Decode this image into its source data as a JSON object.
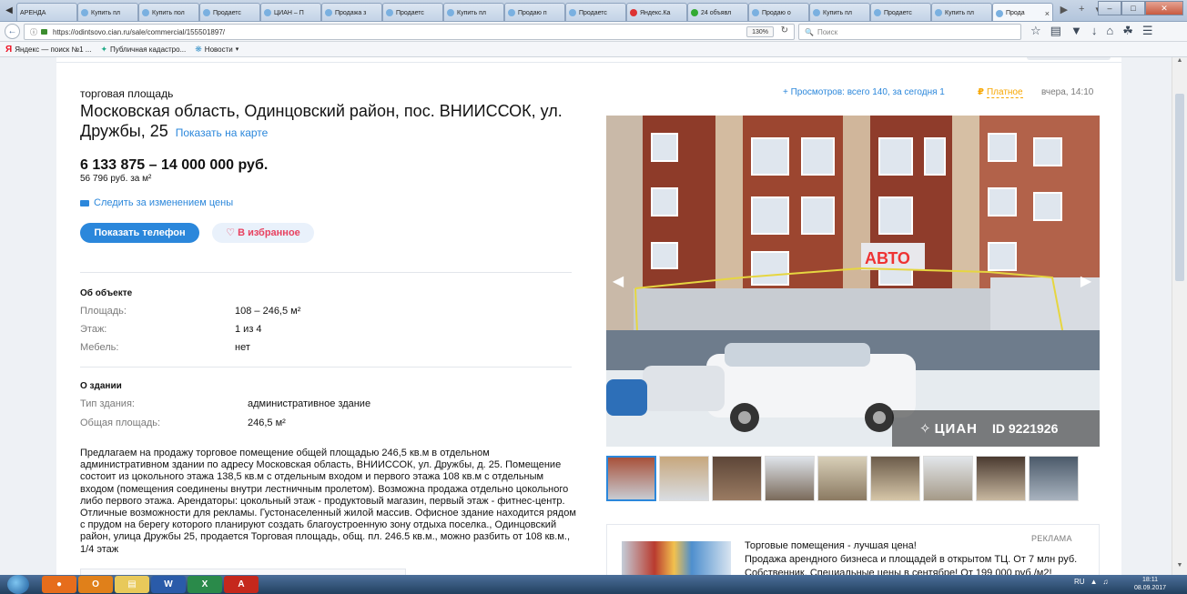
{
  "browser": {
    "tabs": [
      {
        "label": "АРЕНДА",
        "fav": "none"
      },
      {
        "label": "Купить пл",
        "fav": "blue"
      },
      {
        "label": "Купить пол",
        "fav": "blue"
      },
      {
        "label": "Продаетс",
        "fav": "blue"
      },
      {
        "label": "ЦИАН – П",
        "fav": "blue"
      },
      {
        "label": "Продажа з",
        "fav": "blue"
      },
      {
        "label": "Продаетс",
        "fav": "blue"
      },
      {
        "label": "Купить пл",
        "fav": "blue"
      },
      {
        "label": "Продаю п",
        "fav": "blue"
      },
      {
        "label": "Продаетс",
        "fav": "blue"
      },
      {
        "label": "Яндекс.Ка",
        "fav": "red"
      },
      {
        "label": "24 объявл",
        "fav": "green"
      },
      {
        "label": "Продаю о",
        "fav": "blue"
      },
      {
        "label": "Купить пл",
        "fav": "blue"
      },
      {
        "label": "Продаетс",
        "fav": "blue"
      },
      {
        "label": "Купить пл",
        "fav": "blue"
      },
      {
        "label": "Прода",
        "fav": "blue"
      }
    ],
    "url": "https://odintsovo.cian.ru/sale/commercial/155501897/",
    "zoom": "130%",
    "search_placeholder": "Поиск",
    "bookmarks": [
      {
        "label": "Яндекс — поиск №1 ...",
        "icon": "yandex-icon"
      },
      {
        "label": "Публичная кадастро...",
        "icon": "map-icon"
      },
      {
        "label": "Новости",
        "icon": "news-icon"
      }
    ]
  },
  "listing": {
    "kind": "торговая площадь",
    "address": "Московская область, Одинцовский район, пос. ВНИИССОК, ул. Дружбы, 25",
    "map_link": "Показать на карте",
    "price": "6 133 875 – 14 000 000 руб.",
    "price_per_m2": "56 796 руб. за м²",
    "follow_price": "Следить за изменением цены",
    "show_phone": "Показать телефон",
    "favorite": "В избранное",
    "views": "+ Просмотров: всего 140, за сегодня 1",
    "paid": "Платное",
    "date": "вчера, 14:10"
  },
  "about_object": {
    "title": "Об объекте",
    "rows": [
      {
        "label": "Площадь:",
        "value": "108 – 246,5 м²"
      },
      {
        "label": "Этаж:",
        "value": "1 из 4"
      },
      {
        "label": "Мебель:",
        "value": "нет"
      }
    ]
  },
  "about_building": {
    "title": "О здании",
    "rows": [
      {
        "label": "Тип здания:",
        "value": "административное здание"
      },
      {
        "label": "Общая площадь:",
        "value": "246,5 м²"
      }
    ]
  },
  "description": "Предлагаем на продажу торговое помещение общей площадью 246,5 кв.м в отдельном административном здании по адресу Московская область, ВНИИССОК, ул. Дружбы, д. 25. Помещение состоит из цокольного этажа 138,5 кв.м с отдельным входом и первого этажа 108 кв.м с отдельным входом (помещения соединены внутри лестничным пролетом). Возможна продажа отдельно цокольного либо первого этажа. Арендаторы: цокольный этаж - продуктовый магазин, первый этаж - фитнес-центр. Отличные возможности для рекламы. Густонаселенный жилой массив. Офисное здание находится рядом с прудом на берегу которого планируют создать благоустроенную зону отдыха поселка., Одинцовский район, улица Дружбы 25, продается Торговая площадь, общ. пл. 246.5 кв.м., можно разбить от 108 кв.м., 1/4 этаж",
  "gallery": {
    "brand": "ЦИАН",
    "photo_id": "ID 9221926",
    "sign_text": "АВТО",
    "thumbnail_count": 9
  },
  "ad": {
    "label": "РЕКЛАМА",
    "title": "Торговые помещения - лучшая цена!",
    "text": "Продажа арендного бизнеса и площадей в открытом ТЦ. От 7 млн руб. Собственник. Специальные цены в сентябре! От 199 000 руб./м2!"
  },
  "taskbar": {
    "lang": "RU",
    "time": "18:11",
    "date": "08.09.2017"
  },
  "colors": {
    "accent": "#2b87db",
    "favorite": "#e84260",
    "paid": "#f7a600"
  }
}
